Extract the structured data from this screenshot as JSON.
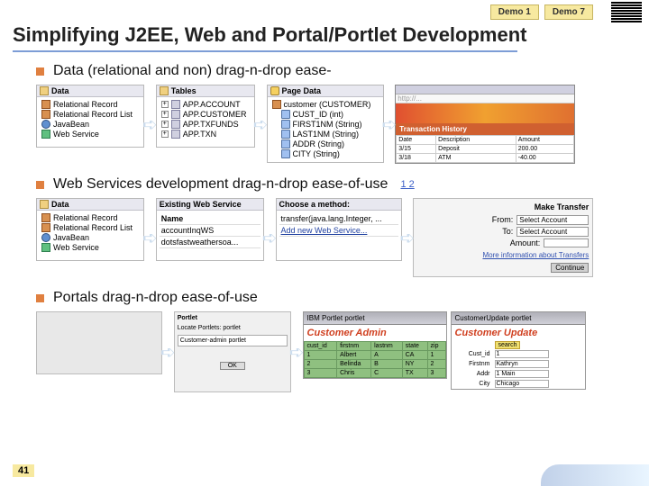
{
  "topbar": {
    "demo1": "Demo 1",
    "demo7": "Demo 7"
  },
  "title": "Simplifying J2EE, Web and Portal/Portlet Development",
  "section1": {
    "bullet": "Data (relational and non) drag-n-drop ease-",
    "data_panel": {
      "title": "Data",
      "items": [
        "Relational Record",
        "Relational Record List",
        "JavaBean",
        "Web Service"
      ]
    },
    "tables_panel": {
      "title": "Tables",
      "items": [
        "APP.ACCOUNT",
        "APP.CUSTOMER",
        "APP.TXFUNDS",
        "APP.TXN"
      ]
    },
    "pagedata_panel": {
      "title": "Page Data",
      "record": "customer (CUSTOMER)",
      "cols": [
        "CUST_ID (int)",
        "FIRST1NM (String)",
        "LAST1NM (String)",
        "ADDR (String)",
        "CITY (String)"
      ]
    },
    "browser": {
      "breadcrumb": "Transaction History",
      "rows": [
        [
          "Date",
          "Description",
          "Amount"
        ],
        [
          "3/15",
          "Deposit",
          "200.00"
        ],
        [
          "3/18",
          "ATM",
          "-40.00"
        ]
      ]
    }
  },
  "section2": {
    "bullet": "Web Services development drag-n-drop ease-of-use",
    "demo_links": "1 2",
    "existing_panel": {
      "title": "Existing Web Service",
      "col": "Name",
      "rows": [
        "accountInqWS",
        "dotsfastweathersoa..."
      ]
    },
    "method_panel": {
      "title": "Choose a method:",
      "row": "transfer(java.lang.Integer, ...",
      "add": "Add new Web Service..."
    },
    "form": {
      "title": "Make Transfer",
      "from_label": "From:",
      "to_label": "To:",
      "amount_label": "Amount:",
      "select_placeholder": "Select Account",
      "info": "More information about Transfers",
      "button": "Continue"
    }
  },
  "section3": {
    "bullet": "Portals drag-n-drop ease-of-use",
    "dlg": {
      "title": "Portlet",
      "opt1": "Locate Portlets: portlet",
      "opt2": "Customer-admin portlet",
      "button": "OK"
    },
    "admin": {
      "head": "IBM Portlet portlet",
      "brand": "Customer Admin",
      "hdr": [
        "cust_id",
        "firstnm",
        "lastnm",
        "state",
        "zip"
      ],
      "rows": [
        [
          "1",
          "Albert",
          "A",
          "CA",
          "1"
        ],
        [
          "2",
          "Belinda",
          "B",
          "NY",
          "2"
        ],
        [
          "3",
          "Chris",
          "C",
          "TX",
          "3"
        ]
      ]
    },
    "update": {
      "head": "CustomerUpdate portlet",
      "brand": "Customer Update",
      "search_label": "search",
      "fields": [
        [
          "Cust_id",
          "1"
        ],
        [
          "Firstnm",
          "Kathryn"
        ],
        [
          "Addr",
          "1 Main"
        ],
        [
          "City",
          "Chicago"
        ]
      ]
    }
  },
  "slide_number": "41"
}
